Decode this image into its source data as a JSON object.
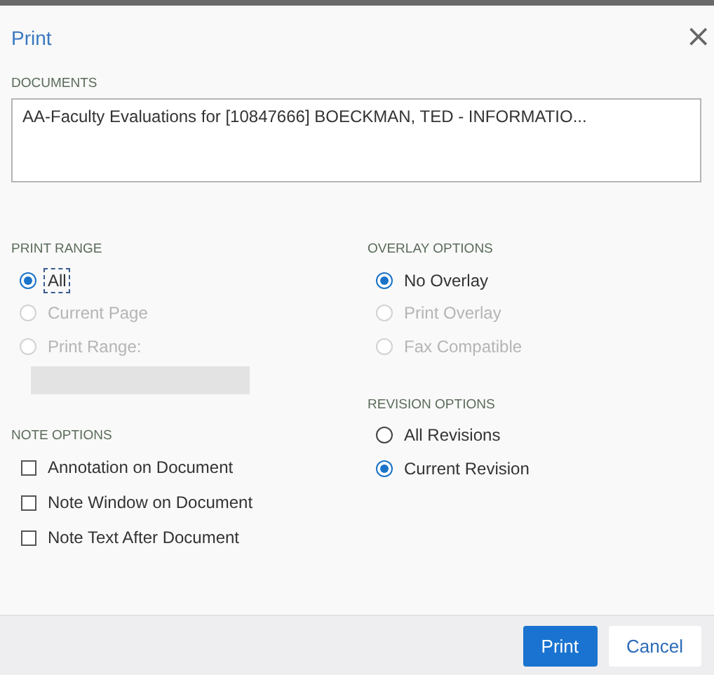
{
  "window": {
    "title": "Print",
    "close": "×"
  },
  "documents": {
    "label": "DOCUMENTS",
    "items": [
      "AA-Faculty Evaluations for [10847666] BOECKMAN, TED - INFORMATIO..."
    ]
  },
  "print_range": {
    "label": "PRINT RANGE",
    "options": [
      {
        "label": "All",
        "selected": true,
        "disabled": false,
        "focused": true
      },
      {
        "label": "Current Page",
        "selected": false,
        "disabled": true,
        "focused": false
      },
      {
        "label": "Print Range:",
        "selected": false,
        "disabled": true,
        "focused": false
      }
    ],
    "range_field": {
      "disabled": true
    }
  },
  "note_options": {
    "label": "NOTE OPTIONS",
    "options": [
      {
        "label": "Annotation on Document",
        "checked": false
      },
      {
        "label": "Note Window on Document",
        "checked": false
      },
      {
        "label": "Note Text After Document",
        "checked": false
      }
    ]
  },
  "overlay_options": {
    "label": "OVERLAY OPTIONS",
    "options": [
      {
        "label": "No Overlay",
        "selected": true,
        "disabled": false,
        "focused": false
      },
      {
        "label": "Print Overlay",
        "selected": false,
        "disabled": true,
        "focused": false
      },
      {
        "label": "Fax Compatible",
        "selected": false,
        "disabled": true,
        "focused": false
      }
    ]
  },
  "revision_options": {
    "label": "REVISION OPTIONS",
    "options": [
      {
        "label": "All Revisions",
        "selected": false,
        "disabled": false,
        "focused": false
      },
      {
        "label": "Current Revision",
        "selected": true,
        "disabled": false,
        "focused": false
      }
    ]
  },
  "buttons": [
    {
      "label": "Print",
      "kind": "primary"
    },
    {
      "label": "Cancel",
      "kind": "secondary"
    }
  ]
}
